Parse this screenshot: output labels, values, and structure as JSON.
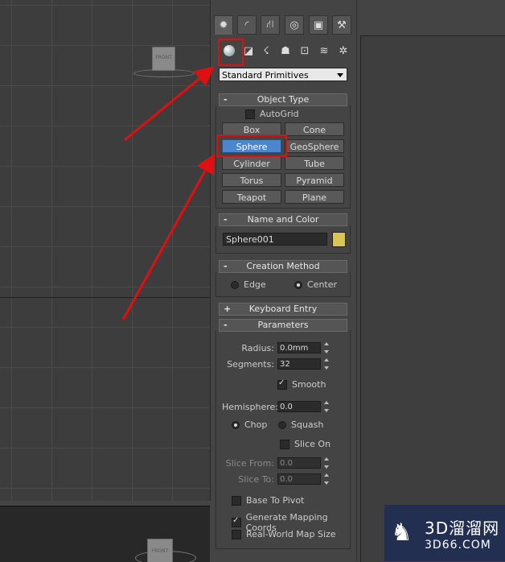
{
  "viewport_main": {
    "cube_label": "FRONT"
  },
  "viewport_bottom": {
    "cube_label": "FRONT"
  },
  "tabs": [
    {
      "name": "create",
      "glyph": "✹"
    },
    {
      "name": "modify",
      "glyph": "◜"
    },
    {
      "name": "hierarchy",
      "glyph": "⛙"
    },
    {
      "name": "motion",
      "glyph": "◎"
    },
    {
      "name": "display",
      "glyph": "▣"
    },
    {
      "name": "utilities",
      "glyph": "⚒"
    }
  ],
  "subcategories": [
    {
      "name": "geometry",
      "glyph": ""
    },
    {
      "name": "shapes",
      "glyph": "◪"
    },
    {
      "name": "lights",
      "glyph": "☇"
    },
    {
      "name": "cameras",
      "glyph": "☗"
    },
    {
      "name": "helpers",
      "glyph": "⊡"
    },
    {
      "name": "space-warps",
      "glyph": "≋"
    },
    {
      "name": "systems",
      "glyph": "✲"
    }
  ],
  "category_dropdown": {
    "value": "Standard Primitives"
  },
  "object_type": {
    "title": "Object Type",
    "sign": "-",
    "autogrid_label": "AutoGrid",
    "buttons": [
      {
        "label": "Box"
      },
      {
        "label": "Cone"
      },
      {
        "label": "Sphere"
      },
      {
        "label": "GeoSphere"
      },
      {
        "label": "Cylinder"
      },
      {
        "label": "Tube"
      },
      {
        "label": "Torus"
      },
      {
        "label": "Pyramid"
      },
      {
        "label": "Teapot"
      },
      {
        "label": "Plane"
      }
    ],
    "selected": "Sphere"
  },
  "name_color": {
    "title": "Name and Color",
    "sign": "-",
    "name_value": "Sphere001",
    "color": "#d8c65a"
  },
  "creation_method": {
    "title": "Creation Method",
    "sign": "-",
    "options": [
      {
        "label": "Edge",
        "on": false
      },
      {
        "label": "Center",
        "on": true
      }
    ]
  },
  "keyboard_entry": {
    "title": "Keyboard Entry",
    "sign": "+"
  },
  "parameters": {
    "title": "Parameters",
    "sign": "-",
    "radius_label": "Radius:",
    "radius_value": "0.0mm",
    "segments_label": "Segments:",
    "segments_value": "32",
    "smooth_label": "Smooth",
    "hemisphere_label": "Hemisphere:",
    "hemisphere_value": "0.0",
    "chop_label": "Chop",
    "squash_label": "Squash",
    "slice_on_label": "Slice On",
    "slice_from_label": "Slice From:",
    "slice_from_value": "0.0",
    "slice_to_label": "Slice To:",
    "slice_to_value": "0.0",
    "base_to_pivot_label": "Base To Pivot",
    "gen_mapping_label": "Generate Mapping Coords",
    "real_world_label": "Real-World Map Size"
  },
  "watermark": {
    "line1": "3D溜溜网",
    "line2": "3D66.COM"
  },
  "colors": {
    "selected_button": "#4d86d0",
    "highlight_red": "#e01010"
  }
}
